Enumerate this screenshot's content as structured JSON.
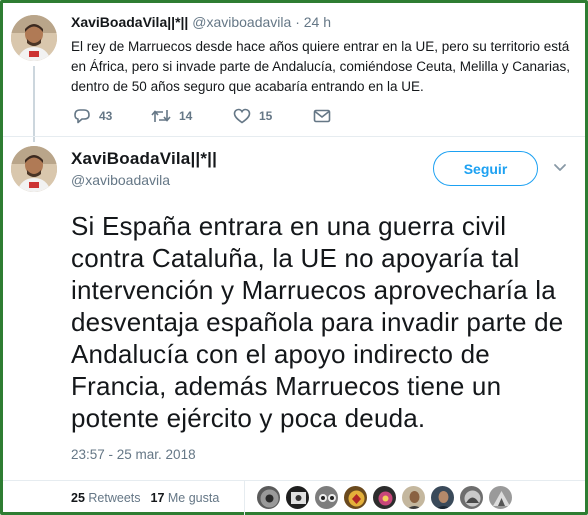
{
  "tweet1": {
    "display_name": "XaviBoadaVila||*||",
    "handle": "@xaviboadavila",
    "separator": "·",
    "time": "24 h",
    "text": "El rey de Marruecos desde hace años quiere entrar en la UE, pero su territorio está en África, pero si invade parte de Andalucía, comiéndose Ceuta, Melilla y Canarias, dentro de 50 años seguro que acabaría entrando en la UE.",
    "actions": {
      "replies": "43",
      "retweets": "14",
      "likes": "15"
    }
  },
  "tweet2": {
    "display_name": "XaviBoadaVila||*||",
    "handle": "@xaviboadavila",
    "follow_label": "Seguir",
    "text": "Si España entrara en una guerra civil contra Cataluña, la UE no apoyaría tal intervención y Marruecos aprovecharía la desventaja española para invadir parte de Andalucía con el apoyo indirecto de Francia, además Marruecos tiene un potente ejército y poca deuda.",
    "timestamp": "23:57 - 25 mar. 2018",
    "stats": {
      "retweets_count": "25",
      "retweets_label": "Retweets",
      "likes_count": "17",
      "likes_label": "Me gusta"
    }
  },
  "colors": {
    "accent": "#1da1f2",
    "muted": "#657786",
    "text": "#14171a",
    "frame": "#2e7d32"
  },
  "icons": [
    "reply-icon",
    "retweet-icon",
    "like-icon",
    "direct-message-icon",
    "chevron-down-icon"
  ]
}
